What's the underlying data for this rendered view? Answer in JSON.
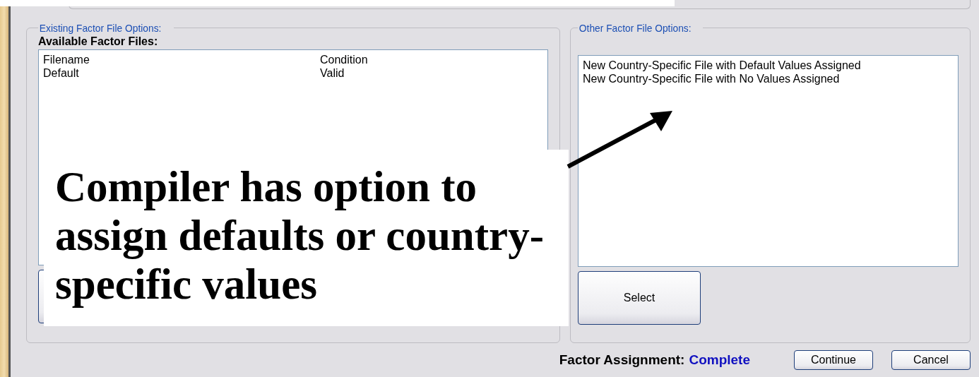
{
  "existing_group": {
    "legend": "Existing Factor File Options:",
    "heading": "Available Factor Files:",
    "columns": [
      "Filename",
      "Condition"
    ],
    "rows": [
      {
        "cells": [
          "Default",
          "Valid"
        ],
        "selected": false
      }
    ]
  },
  "other_group": {
    "legend": "Other Factor File Options:",
    "items": [
      {
        "label": "New Country-Specific File with Default Values Assigned",
        "selected": false
      },
      {
        "label": "New Country-Specific File with No Values Assigned",
        "selected": false
      }
    ],
    "button": "Select"
  },
  "status": {
    "label": "Factor Assignment:",
    "value": "Complete"
  },
  "buttons": [
    "Continue",
    "Cancel"
  ],
  "callout": {
    "text": "Compiler has option to assign defaults or country-specific values"
  }
}
